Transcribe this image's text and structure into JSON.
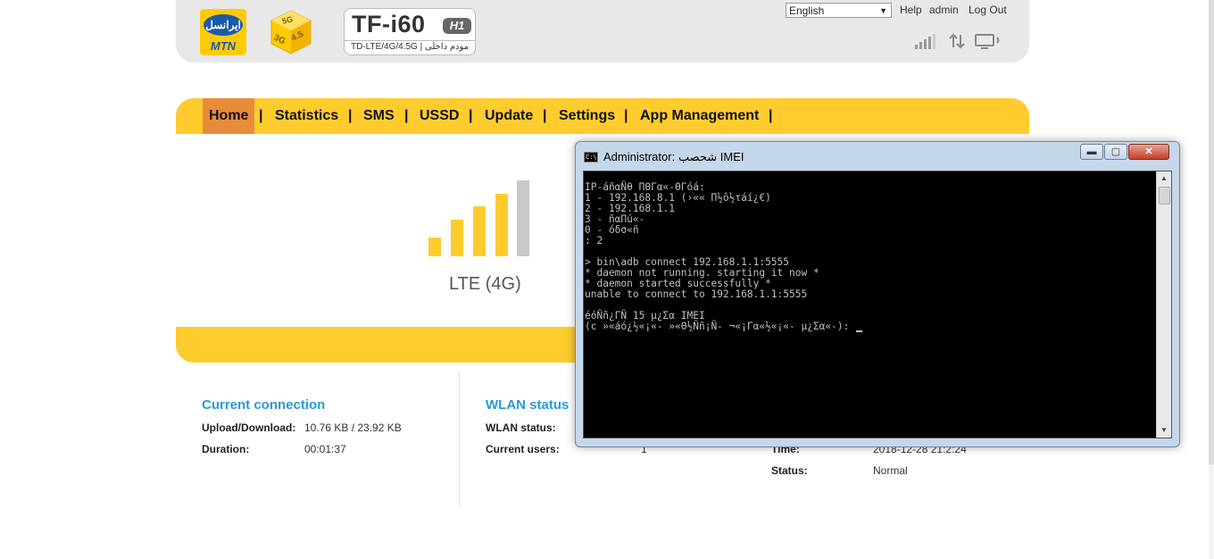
{
  "header": {
    "operator_logo_text": "ایرانسل",
    "operator_brand": "MTN",
    "network_badge": [
      "5G",
      "3G",
      "4.5"
    ],
    "model_name": "TF-i60",
    "model_badge": "H1",
    "model_subtitle": "TD-LTE/4G/4.5G | مودم داخلی",
    "language_selected": "English",
    "links": {
      "help": "Help",
      "admin": "admin",
      "logout": "Log Out"
    },
    "icons": [
      "signal-strength-icon",
      "data-transfer-icon",
      "device-icon"
    ]
  },
  "nav": {
    "items": [
      {
        "label": "Home",
        "active": true
      },
      {
        "label": "Statistics"
      },
      {
        "label": "SMS"
      },
      {
        "label": "USSD"
      },
      {
        "label": "Update"
      },
      {
        "label": "Settings"
      },
      {
        "label": "App Management"
      }
    ],
    "separator": "|"
  },
  "signal": {
    "network_type": "LTE (4G)",
    "bars_total": 5,
    "bars_active": 4,
    "active_color": "#ffcb2d",
    "inactive_color": "#c8c8c8"
  },
  "current_connection": {
    "title": "Current connection",
    "rows": [
      {
        "label": "Upload/Download:",
        "value": "10.76 KB / 23.92 KB"
      },
      {
        "label": "Duration:",
        "value": "00:01:37"
      }
    ]
  },
  "wlan_status": {
    "title": "WLAN status",
    "rows": [
      {
        "label": "WLAN status:",
        "value": ""
      },
      {
        "label": "Current users:",
        "value": "1"
      }
    ]
  },
  "device_info": {
    "rows": [
      {
        "label": "Time:",
        "value": "2018-12-28 21:2:24"
      },
      {
        "label": "Status:",
        "value": "Normal"
      }
    ]
  },
  "console": {
    "title": "Administrator: شحصب IMEI",
    "lines": [
      "IP-áñαÑθ ΠΘΓα«-ΘΓóá:",
      "1 - 192.168.8.1 (›«« Π½ô½τáí¿€)",
      "2 - 192.168.1.1",
      "3 - ñαΠú«-",
      "0 - óδσ«ñ",
      ": 2",
      "",
      "> bin\\adb connect 192.168.1.1:5555",
      "* daemon not running. starting it now *",
      "* daemon started successfully *",
      "unable to connect to 192.168.1.1:5555",
      "",
      "éóÑñ¿ΓÑ 15 µ¿Σα IMEI",
      "(c »«áó¿½«¡«- »«Θ½Ññ¡Ñ- ¬«¡Γα«½«¡«- µ¿Σα«-): "
    ],
    "buttons": {
      "minimize": "▬",
      "maximize": "▢",
      "close": "✕"
    },
    "icon_label": "C:\\"
  },
  "colors": {
    "nav_bg": "#ffcb2d",
    "nav_active": "#e98c3a",
    "header_bg": "#e8e8e8",
    "link_blue": "#2a9ad6",
    "mtn_yellow": "#ffcb05",
    "mtn_blue": "#1a5aa8"
  }
}
